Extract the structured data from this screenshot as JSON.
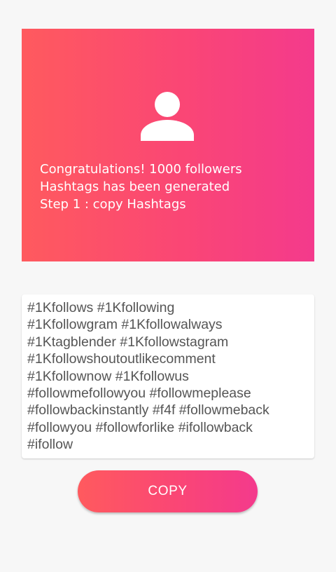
{
  "hero": {
    "icon": "person-icon",
    "gradient_start": "#ff5a5e",
    "gradient_end": "#f43a8c",
    "lines": [
      "Congratulations! 1000 followers",
      "Hashtags has been generated",
      "Step 1 : copy Hashtags"
    ]
  },
  "hashtags": {
    "lines": [
      "#1Kfollows #1Kfollowing",
      "#1Kfollowgram #1Kfollowalways",
      "#1Ktagblender #1Kfollowstagram",
      "#1Kfollowshoutoutlikecomment",
      "#1Kfollownow #1Kfollowus",
      "#followmefollowyou #followmeplease",
      "#followbackinstantly #f4f #followmeback",
      "#followyou #followforlike #ifollowback",
      "#ifollow"
    ]
  },
  "copy_button": {
    "label": "COPY"
  }
}
